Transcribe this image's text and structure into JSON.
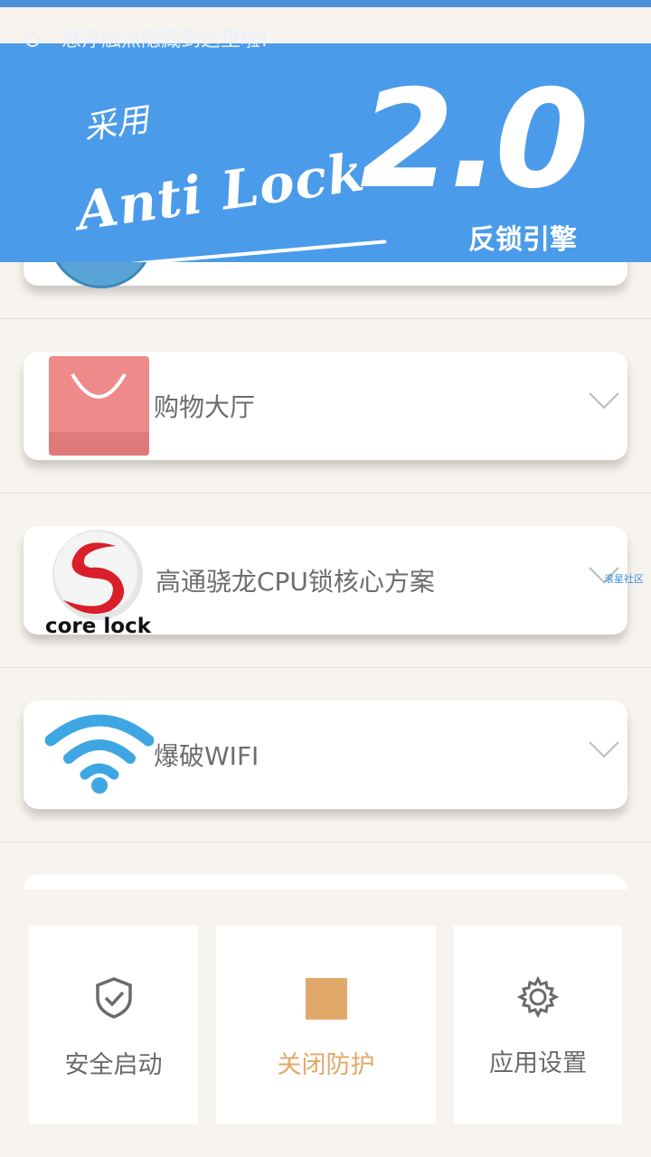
{
  "status": {
    "notice": "悬浮触点隐藏到这里啦!"
  },
  "banner": {
    "prefix": "采用",
    "engine": "Anti Lock",
    "version": "2.0",
    "subtitle": "反锁引擎"
  },
  "items": [
    {
      "label": "购物大厅",
      "icon": "shopping-bag-icon"
    },
    {
      "label": "高通骁龙CPU锁核心方案",
      "icon": "core-lock-icon",
      "icon_caption": "core lock"
    },
    {
      "label": "爆破WIFI",
      "icon": "wifi-icon"
    }
  ],
  "watermark": "滚星社区",
  "nav": [
    {
      "label": "安全启动",
      "icon": "shield-check-icon"
    },
    {
      "label": "关闭防护",
      "icon": "stop-icon",
      "color": "#e0a96a"
    },
    {
      "label": "应用设置",
      "icon": "gear-icon"
    }
  ]
}
